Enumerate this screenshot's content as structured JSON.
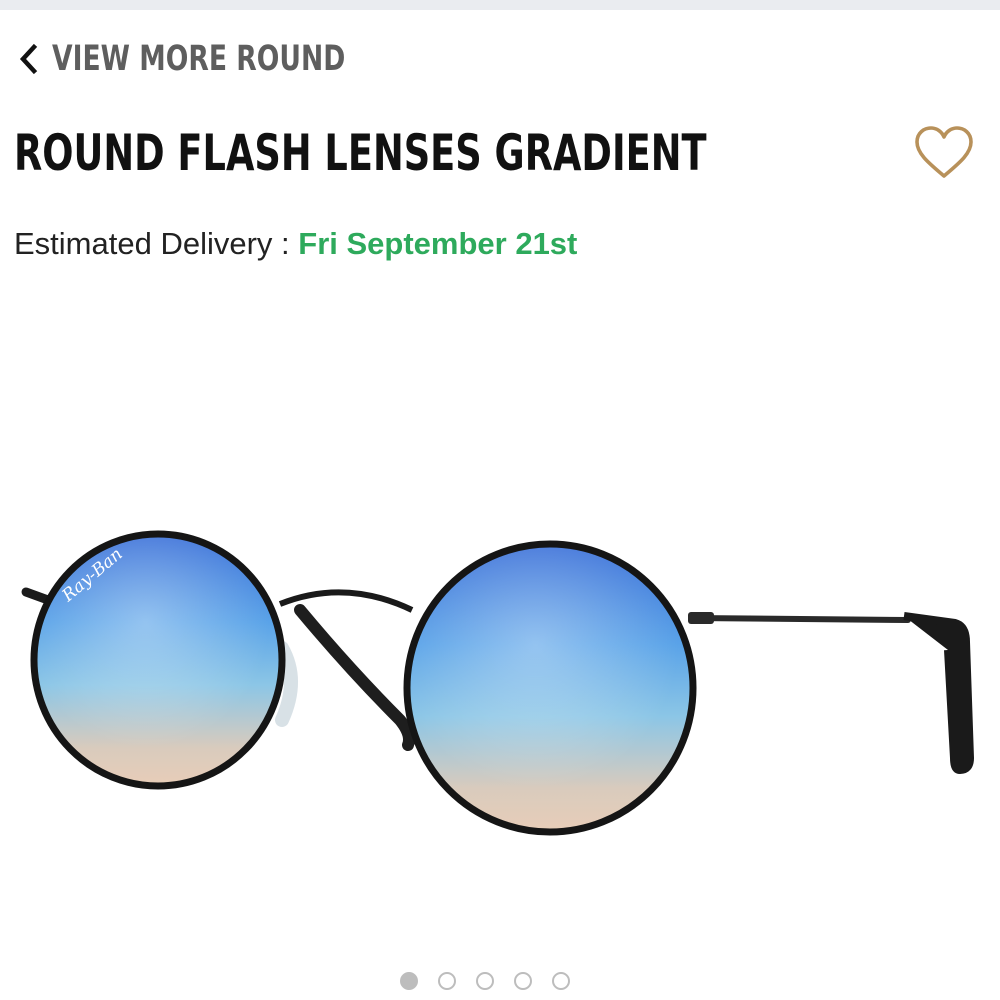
{
  "nav": {
    "back_label": "VIEW MORE ROUND",
    "back_icon": "chevron-left-icon"
  },
  "product": {
    "title": "ROUND FLASH LENSES GRADIENT",
    "wishlist_icon": "heart-outline-icon",
    "brand_logo_text": "Ray-Ban",
    "image_alt": "Round sunglasses with blue gradient flash lenses and black metal frame"
  },
  "delivery": {
    "label": "Estimated Delivery :",
    "date": "Fri September 21st"
  },
  "carousel": {
    "total": 5,
    "active_index": 0
  },
  "colors": {
    "delivery_date": "#2eaa5c",
    "wishlist_heart": "#b8915a",
    "back_link": "#5e5e5e",
    "lens_top": "#3a6fd8",
    "lens_bottom": "#e8cdb8"
  }
}
